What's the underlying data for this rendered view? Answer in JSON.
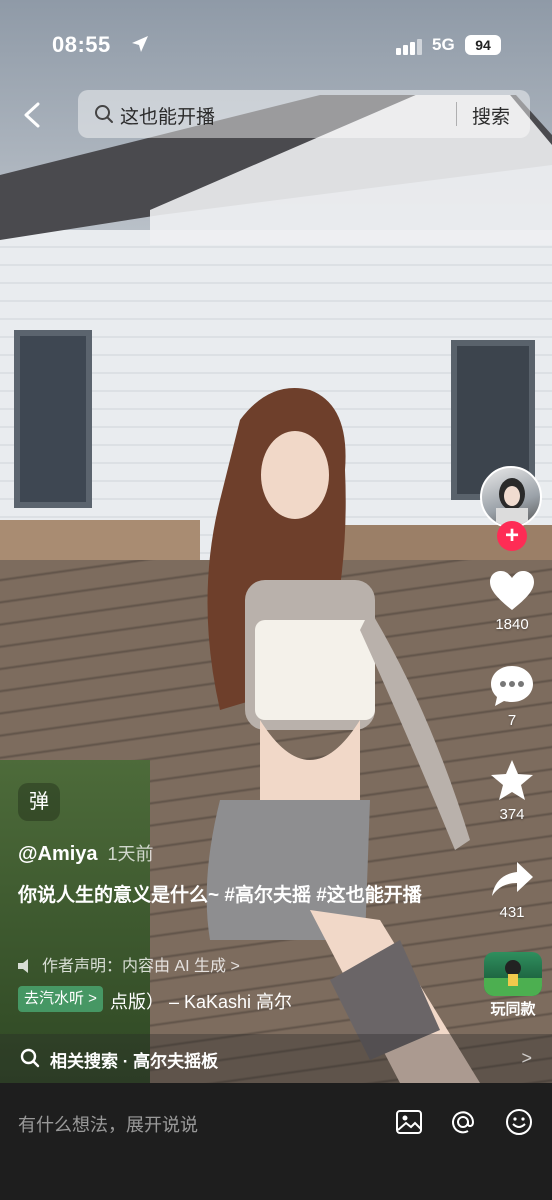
{
  "status_bar": {
    "time": "08:55",
    "network": "5G",
    "battery": "94"
  },
  "search": {
    "query": "这也能开播",
    "button_label": "搜索"
  },
  "right_rail": {
    "likes": "1840",
    "comments": "7",
    "favorites": "374",
    "shares": "431",
    "follow_symbol": "+",
    "same_style_label": "玩同款"
  },
  "post": {
    "danmu_label": "弹",
    "author": "@Amiya",
    "time_ago": "1天前",
    "caption": "你说人生的意义是什么~ #高尔夫摇 #这也能开播",
    "declaration": "作者声明：内容由 AI 生成 >",
    "listen_tag": "去汽水听 >",
    "music": "点版） – KaKashi    高尔"
  },
  "related": {
    "text": "相关搜索 · 高尔夫摇板",
    "arrow": ">"
  },
  "comment_bar": {
    "placeholder": "有什么想法，展开说说"
  },
  "colors": {
    "follow_red": "#fe2c55",
    "listen_green": "#4caf78",
    "bar_bg": "#1e1e1e"
  },
  "icons": [
    "back-arrow-icon",
    "search-icon",
    "location-arrow-icon",
    "signal-icon",
    "heart-icon",
    "comment-icon",
    "star-icon",
    "share-icon",
    "image-icon",
    "at-icon",
    "emoji-icon"
  ]
}
